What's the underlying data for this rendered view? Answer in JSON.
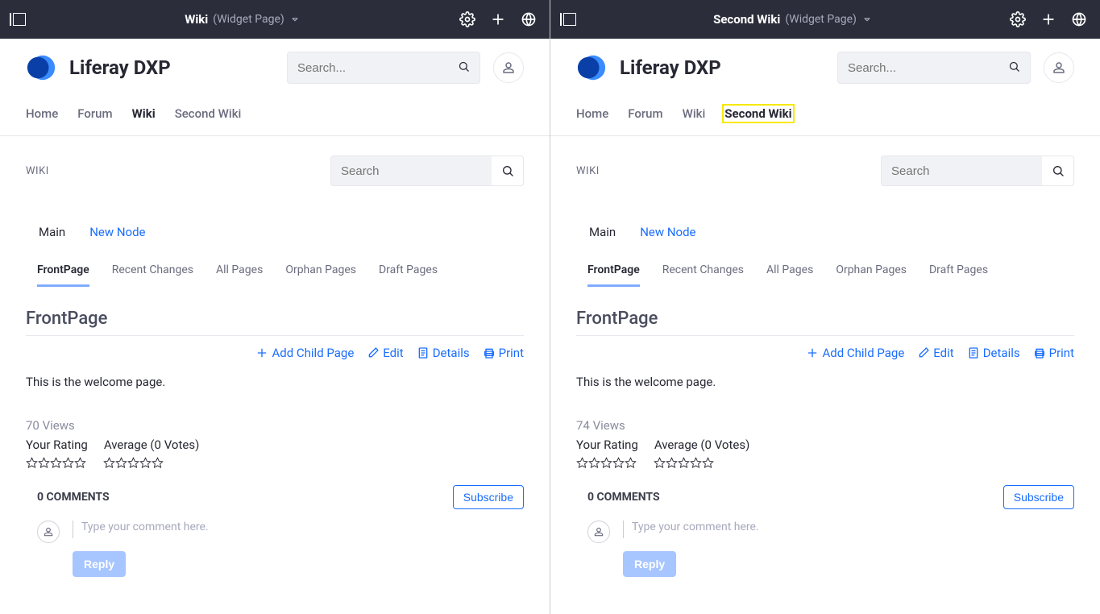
{
  "panels": [
    {
      "topbar": {
        "title": "Wiki",
        "subtitle": "(Widget Page)"
      },
      "brand": "Liferay DXP",
      "globalSearchPlaceholder": "Search...",
      "nav": [
        "Home",
        "Forum",
        "Wiki",
        "Second Wiki"
      ],
      "activeNavIndex": 2,
      "highlightedNavIndex": -1,
      "portlet": {
        "title": "WIKI",
        "searchPlaceholder": "Search",
        "nodes": [
          "Main",
          "New Node"
        ],
        "activeNodeIndex": 0,
        "tabs": [
          "FrontPage",
          "Recent Changes",
          "All Pages",
          "Orphan Pages",
          "Draft Pages"
        ],
        "activeTabIndex": 0,
        "pageTitle": "FrontPage",
        "actions": {
          "addChild": "Add Child Page",
          "edit": "Edit",
          "details": "Details",
          "print": "Print"
        },
        "content": "This is the welcome page.",
        "views": "70 Views",
        "ratingLabels": {
          "your": "Your Rating",
          "avg": "Average (0 Votes)"
        },
        "commentsTitle": "0 COMMENTS",
        "subscribe": "Subscribe",
        "commentPlaceholder": "Type your comment here.",
        "reply": "Reply"
      }
    },
    {
      "topbar": {
        "title": "Second Wiki",
        "subtitle": "(Widget Page)"
      },
      "brand": "Liferay DXP",
      "globalSearchPlaceholder": "Search...",
      "nav": [
        "Home",
        "Forum",
        "Wiki",
        "Second Wiki"
      ],
      "activeNavIndex": 3,
      "highlightedNavIndex": 3,
      "portlet": {
        "title": "WIKI",
        "searchPlaceholder": "Search",
        "nodes": [
          "Main",
          "New Node"
        ],
        "activeNodeIndex": 0,
        "tabs": [
          "FrontPage",
          "Recent Changes",
          "All Pages",
          "Orphan Pages",
          "Draft Pages"
        ],
        "activeTabIndex": 0,
        "pageTitle": "FrontPage",
        "actions": {
          "addChild": "Add Child Page",
          "edit": "Edit",
          "details": "Details",
          "print": "Print"
        },
        "content": "This is the welcome page.",
        "views": "74 Views",
        "ratingLabels": {
          "your": "Your Rating",
          "avg": "Average (0 Votes)"
        },
        "commentsTitle": "0 COMMENTS",
        "subscribe": "Subscribe",
        "commentPlaceholder": "Type your comment here.",
        "reply": "Reply"
      }
    }
  ]
}
